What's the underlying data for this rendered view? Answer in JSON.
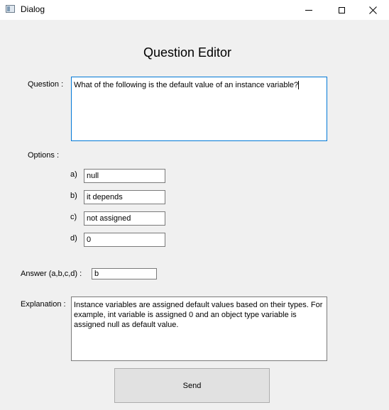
{
  "window": {
    "title": "Dialog",
    "icons": [
      "app-icon",
      "minimize-icon",
      "maximize-icon",
      "close-icon"
    ]
  },
  "form": {
    "heading": "Question Editor",
    "question_label": "Question :",
    "question_value": "What of the following is the default value of an instance variable?",
    "options_label": "Options :",
    "options": [
      {
        "letter": "a)",
        "value": "null"
      },
      {
        "letter": "b)",
        "value": "it depends"
      },
      {
        "letter": "c)",
        "value": "not assigned"
      },
      {
        "letter": "d)",
        "value": "0"
      }
    ],
    "answer_label": "Answer (a,b,c,d) :",
    "answer_value": "b",
    "explanation_label": "Explanation :",
    "explanation_value": "Instance variables are assigned default values based on their types. For example, int variable is assigned 0 and an object type variable is assigned null as default value.",
    "send_label": "Send"
  },
  "colors": {
    "background": "#f0f0f0",
    "focus_border": "#0078d7",
    "button_face": "#e1e1e1"
  }
}
